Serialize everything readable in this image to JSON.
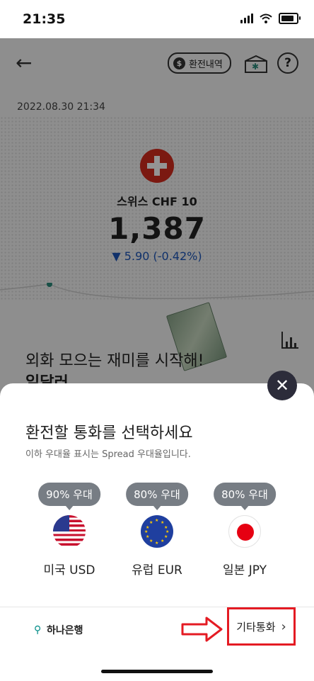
{
  "status_bar": {
    "time": "21:35"
  },
  "header": {
    "history_label": "환전내역",
    "help_label": "?"
  },
  "rate_card": {
    "date": "2022.08.30 21:34",
    "currency_label": "스위스 CHF 10",
    "rate": "1,387",
    "change": "▼ 5.90 (-0.42%)"
  },
  "promo": {
    "line1": "외화 모으는 재미를 시작해!",
    "line2": "일달러"
  },
  "sheet": {
    "title": "환전할 통화를 선택하세요",
    "subtitle": "이하 우대율 표시는 Spread 우대율입니다.",
    "currencies": [
      {
        "discount": "90% 우대",
        "name": "미국 USD",
        "flag_icon": "us-flag-icon"
      },
      {
        "discount": "80% 우대",
        "name": "유럽 EUR",
        "flag_icon": "eu-flag-icon"
      },
      {
        "discount": "80% 우대",
        "name": "일본 JPY",
        "flag_icon": "japan-flag-icon"
      }
    ],
    "bank_name": "하나은행",
    "other_currency_label": "기타통화"
  },
  "colors": {
    "highlight": "#e41b23",
    "decrease": "#1c55b8",
    "bubble": "#777d84"
  }
}
